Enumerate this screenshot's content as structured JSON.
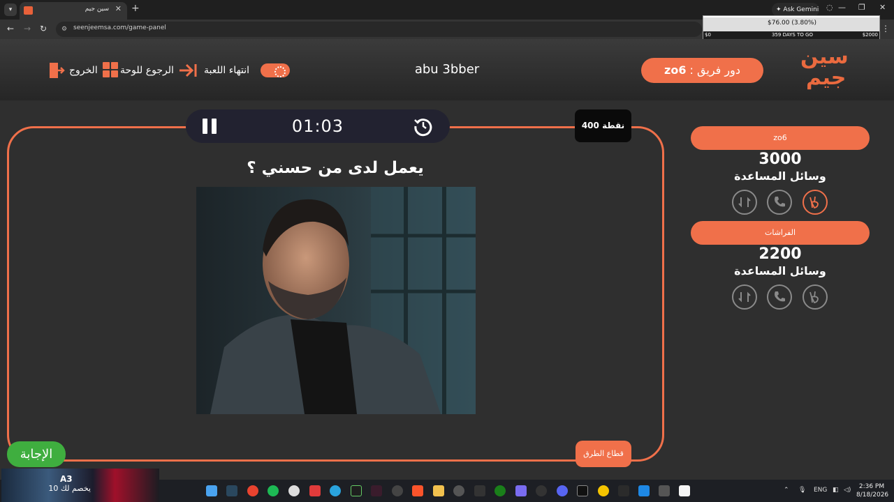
{
  "browser": {
    "tab_title": "سين جيم",
    "url": "seenjeemsa.com/game-panel",
    "ask_gemini": "Ask Gemini",
    "ticker": {
      "value": "$76.00 (3.80%)",
      "left": "$0",
      "middle": "359 DAYS TO GO",
      "right": "$2000"
    }
  },
  "header": {
    "logo_top": "سين",
    "logo_bottom": "جيم",
    "turn_label": "دور فريق :",
    "turn_team": "zo6",
    "game_name": "abu 3bber",
    "end_game": "انتهاء اللعبة",
    "back_to_board": "الرجوع للوحة",
    "exit": "الخروج"
  },
  "question": {
    "timer": "01:03",
    "points": "400 نقطة",
    "text": "يعمل لدى من حسني ؟",
    "road_block": "قطاع الطرق",
    "answer": "الإجابة"
  },
  "teams": [
    {
      "name": "zo6",
      "score": "3000",
      "help_label": "وسائل المساعدة"
    },
    {
      "name": "الفراشات",
      "score": "2200",
      "help_label": "وسائل المساعدة"
    }
  ],
  "taskbar": {
    "widget_title": "A3",
    "widget_sub": "يخصم لك 10",
    "lang": "ENG",
    "time": "2:36 PM",
    "date": "8/18/2026"
  },
  "colors": {
    "accent": "#f0704a",
    "answer_green": "#3fae3f",
    "background": "#2f2f2f"
  }
}
